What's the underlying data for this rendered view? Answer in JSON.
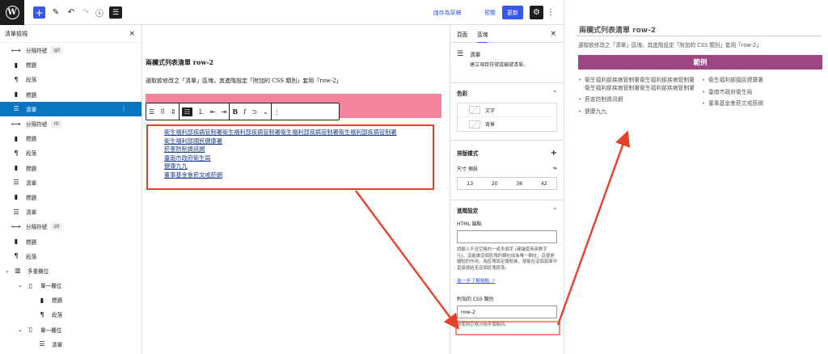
{
  "toolbar": {
    "logo_glyph": "W",
    "add_glyph": "+",
    "edit_glyph": "✎",
    "undo_glyph": "↶",
    "redo_glyph": "↷",
    "info_glyph": "ⓘ",
    "listview_glyph": "☰",
    "save_draft_label": "儲存為草稿",
    "preview_label": "預覽",
    "update_label": "更新",
    "settings_glyph": "⚙",
    "more_glyph": "⋮",
    "accent_color": "#3858e9"
  },
  "list_view": {
    "title": "清單檢視",
    "close_glyph": "×",
    "items": [
      {
        "icon": "⟼",
        "label": "分隔符號",
        "badge": "q0",
        "indent": 0
      },
      {
        "icon": "▮",
        "label": "標題",
        "indent": 0
      },
      {
        "icon": "¶",
        "label": "段落",
        "indent": 0
      },
      {
        "icon": "▮",
        "label": "標題",
        "indent": 0
      },
      {
        "icon": "☰",
        "label": "清單",
        "indent": 0,
        "selected": true
      },
      {
        "icon": "⟼",
        "label": "分隔符號",
        "badge": "r0",
        "indent": 0
      },
      {
        "icon": "▮",
        "label": "標題",
        "indent": 0
      },
      {
        "icon": "¶",
        "label": "段落",
        "indent": 0
      },
      {
        "icon": "▮",
        "label": "標題",
        "indent": 0
      },
      {
        "icon": "☰",
        "label": "清單",
        "indent": 0
      },
      {
        "icon": "▮",
        "label": "標題",
        "indent": 0
      },
      {
        "icon": "☰",
        "label": "清單",
        "indent": 0
      },
      {
        "icon": "⟼",
        "label": "分隔符號",
        "badge": "z0",
        "indent": 0
      },
      {
        "icon": "▮",
        "label": "標題",
        "indent": 0
      },
      {
        "icon": "¶",
        "label": "段落",
        "indent": 0
      },
      {
        "icon": "▥",
        "label": "多重欄位",
        "indent": 0,
        "chevron": "⌄"
      },
      {
        "icon": "▯",
        "label": "單一欄位",
        "indent": 1,
        "chevron": "⌄"
      },
      {
        "icon": "▮",
        "label": "標題",
        "indent": 2
      },
      {
        "icon": "¶",
        "label": "段落",
        "indent": 2
      },
      {
        "icon": "▯",
        "label": "單一欄位",
        "indent": 1,
        "chevron": "⌄"
      },
      {
        "icon": "☰",
        "label": "清單",
        "indent": 2
      }
    ]
  },
  "editor": {
    "heading": "兩欄式列表清單 row-2",
    "description": "選取欲修改之「清單」區塊，其進階設定「附加的 CSS 類別」套用「row-2」",
    "block_toolbar": {
      "transform_glyph": "☰",
      "drag_glyph": "⠿",
      "move_glyph": "⇕",
      "unordered_glyph": "☷",
      "ordered_glyph": "⒈",
      "outdent_glyph": "⇤",
      "indent_glyph": "⇥",
      "bold_glyph": "B",
      "italic_glyph": "I",
      "link_glyph": "⊃",
      "more_rich_glyph": "⌄",
      "options_glyph": "⋮"
    },
    "list_items": [
      "衛生福利部疾病管制署衛生福利部疾病管制署衛生福利部疾病管制署衛生福利部疾病管制署",
      "衛生福利部國民健康署",
      "菸害防制資訊網",
      "臺南市政府衛生局",
      "健康九九",
      "董事基金會菸文戒菸網"
    ]
  },
  "settings": {
    "tabs": [
      "頁面",
      "區塊"
    ],
    "close_glyph": "×",
    "block_icon": "☰",
    "block_name": "清單",
    "block_desc": "建立項目符號或編號清單。",
    "color_section": "色彩",
    "text_color_label": "文字",
    "background_label": "背景",
    "typography_section": "排版樣式",
    "plus_glyph": "+",
    "size_label": "尺寸 預設",
    "size_adjust_glyph": "⇋",
    "size_options": [
      "13",
      "20",
      "36",
      "42"
    ],
    "advanced_section": "進階設定",
    "chevron_up": "⌃",
    "html_anchor_label": "HTML 錨點",
    "html_anchor_value": "",
    "anchor_help": "請輸入不含空格的一或多個字 (建議使用英數字元)，這能讓這個區塊的網址成為唯一網址，這便是錨點的作用，為區塊設定錨點後，便能在這個頁面中直接連結至這個區塊段落。",
    "learn_more_link": "進一步了解錨點 ↗",
    "css_class_label": "附加的 CSS 類別",
    "css_class_value": "row-2",
    "css_class_help": "請使用空格分隔多個類別。"
  },
  "preview": {
    "heading": "兩欄式列表清單 row-2",
    "description": "選取欲修改之「清單」區塊，其進階設定「附加的 CSS 類別」套用「row-2」",
    "banner": "範例",
    "banner_color": "#9e4682",
    "items": [
      "衛生福利部疾病管制署衛生福利部疾病管制署衛生福利部疾病管制署衛生福利部疾病管制署",
      "菸害防制資訊網",
      "健康九九",
      "衛生福利部國民健康署",
      "臺南市政府衛生局",
      "董事基金會菸文戒菸網"
    ]
  },
  "annotation_color": "#e8402a"
}
